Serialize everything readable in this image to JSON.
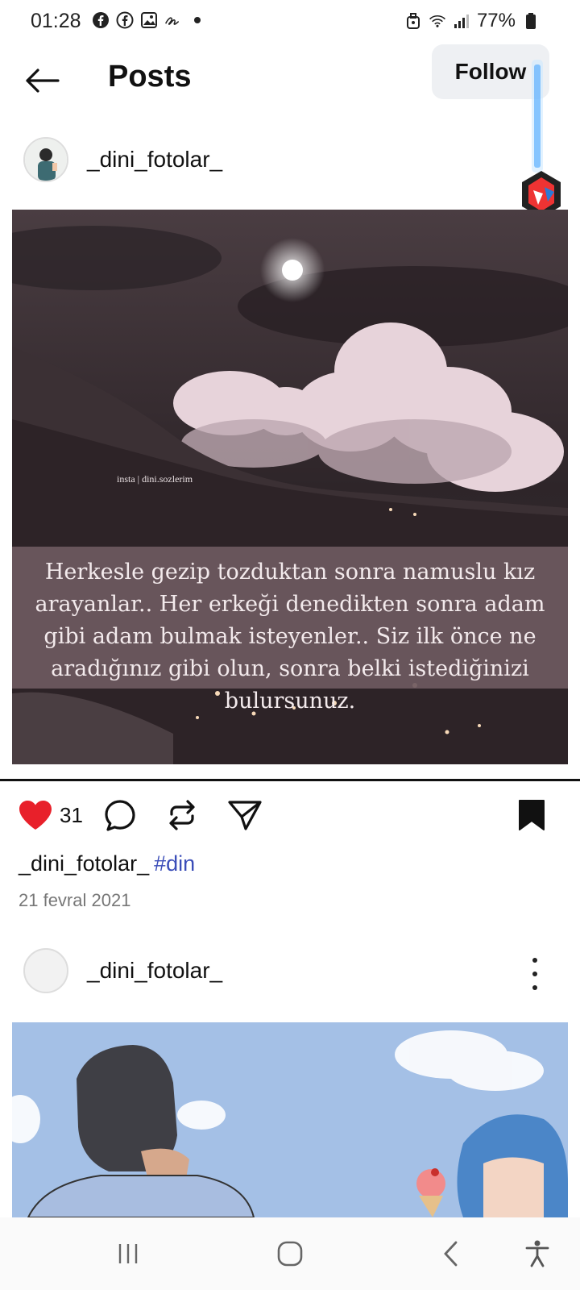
{
  "status_bar": {
    "time": "01:28",
    "battery": "77%"
  },
  "header": {
    "title": "Posts",
    "follow_label": "Follow"
  },
  "posts": [
    {
      "username": "_dini_fotolar_",
      "image_watermark": "insta | dini.sozlerim",
      "quote": "Herkesle gezip tozduktan sonra namuslu kız arayanlar.. Her erkeği denedikten sonra adam gibi adam bulmak isteyenler.. Siz ilk önce ne aradığınız gibi olun, sonra belki istediğinizi bulursunuz.",
      "likes": "31",
      "liked": true,
      "caption_user": "_dini_fotolar_",
      "caption_tag": "#din",
      "date": "21 fevral 2021"
    },
    {
      "username": "_dini_fotolar_"
    }
  ],
  "colors": {
    "like": "#e8202a",
    "hashtag": "#3b4db8",
    "follow_bg": "#eef0f3"
  },
  "icons": {
    "back": "arrow-left-icon",
    "like": "heart-icon",
    "comment": "comment-icon",
    "repost": "repost-icon",
    "share": "send-icon",
    "save": "bookmark-icon",
    "more": "more-vertical-icon"
  }
}
